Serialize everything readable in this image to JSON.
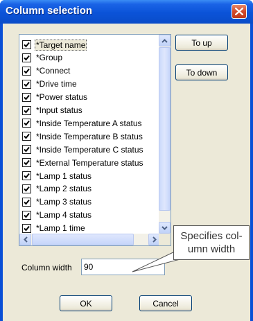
{
  "window": {
    "title": "Column selection"
  },
  "list": {
    "items": [
      "*Target name",
      "*Group",
      "*Connect",
      "*Drive time",
      "*Power status",
      "*Input status",
      "*Inside Temperature A status",
      "*Inside Temperature B status",
      "*Inside Temperature C status",
      "*External Temperature status",
      "*Lamp 1 status",
      "*Lamp 2 status",
      "*Lamp 3 status",
      "*Lamp 4 status",
      "*Lamp 1 time"
    ],
    "all_checked": true,
    "selected_index": 0
  },
  "buttons": {
    "to_up": "To up",
    "to_down": "To down",
    "ok": "OK",
    "cancel": "Cancel"
  },
  "column_width": {
    "label": "Column width",
    "value": "90"
  },
  "callout": {
    "line1": "Specifies col-",
    "line2": "umn width"
  },
  "colors": {
    "titlebar": "#0a4fd6",
    "dialog_bg": "#ece9d8",
    "close": "#d2492a"
  }
}
